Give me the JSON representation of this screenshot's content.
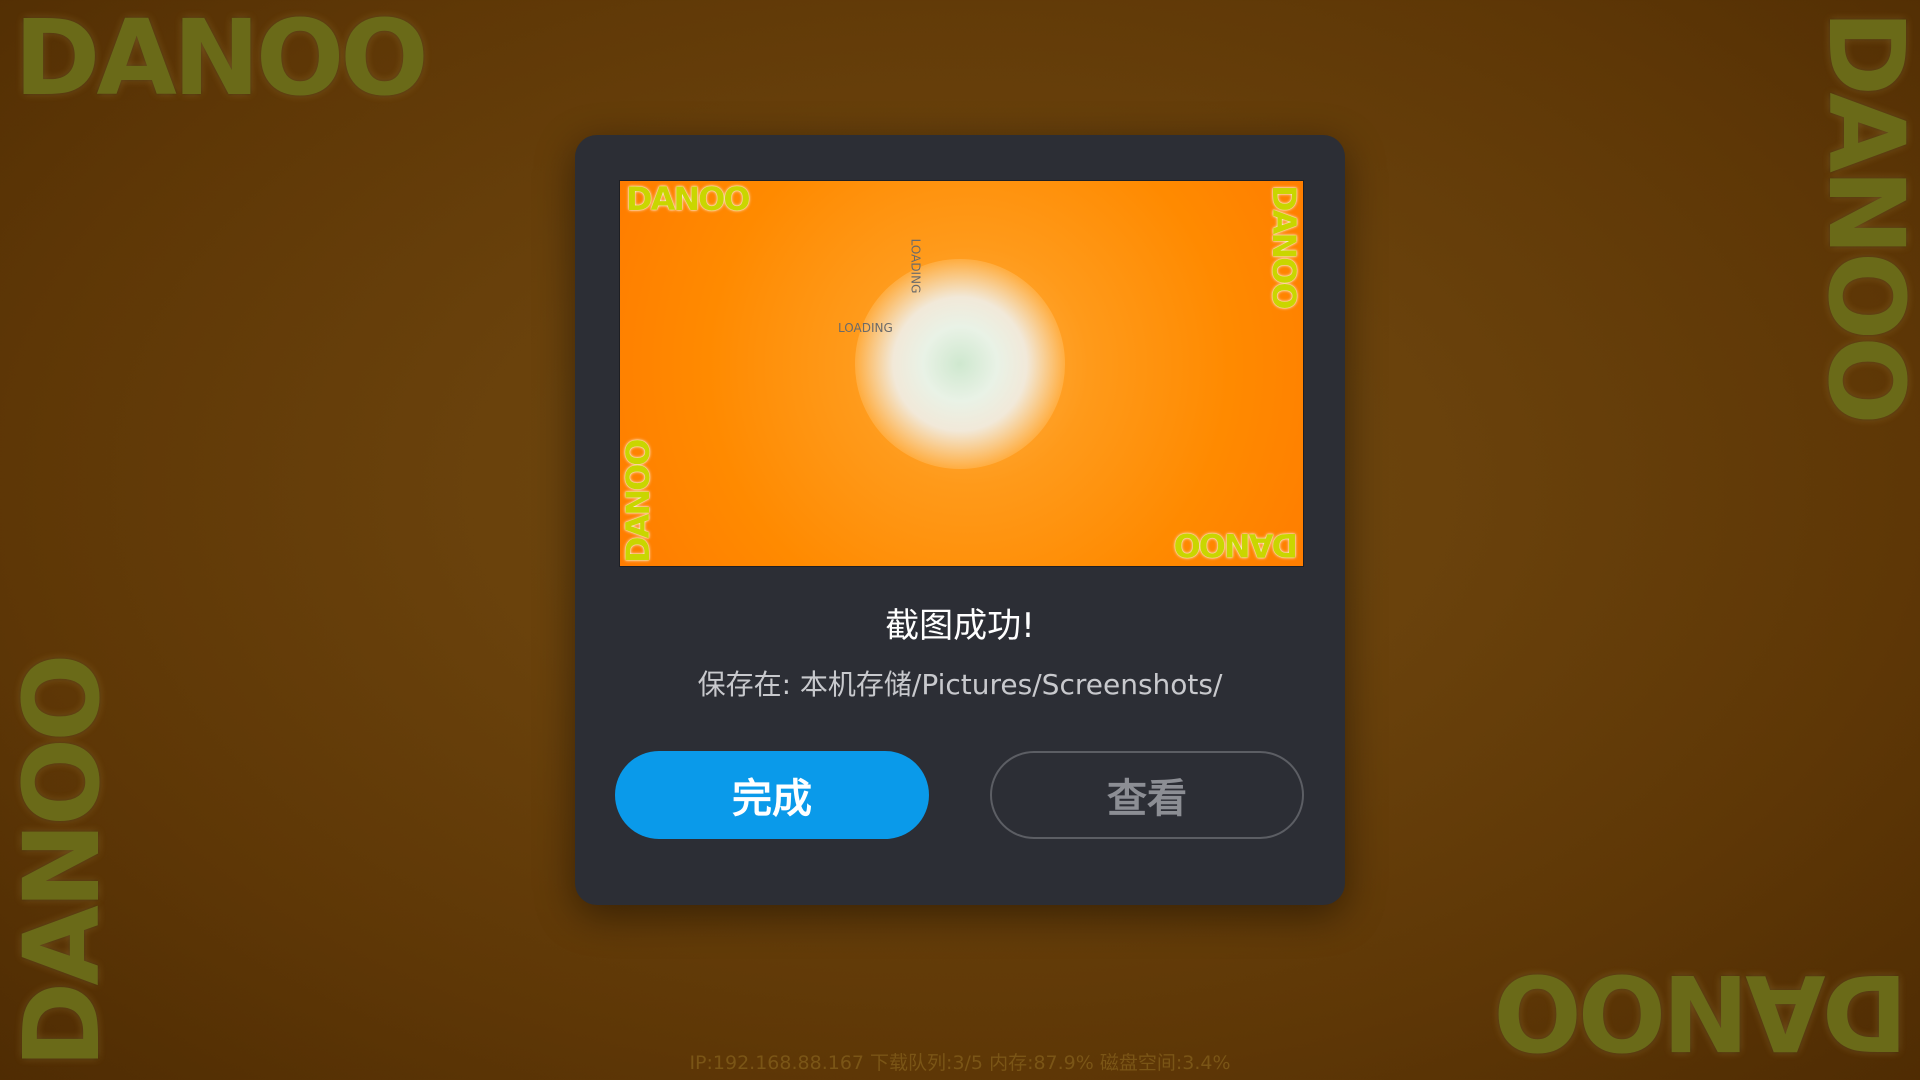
{
  "background": {
    "logo_text": "DANOO",
    "color": "#5e3706"
  },
  "dialog": {
    "preview": {
      "logo_text": "DANOO",
      "loading_text": "LOADING",
      "accent_color": "#ff8a00"
    },
    "title": "截图成功!",
    "saved_path": "保存在: 本机存储/Pictures/Screenshots/",
    "buttons": {
      "done": "完成",
      "view": "查看"
    },
    "done_color": "#0a9aea"
  },
  "status_bar": "IP:192.168.88.167  下载队列:3/5  内存:87.9%  磁盘空间:3.4%"
}
